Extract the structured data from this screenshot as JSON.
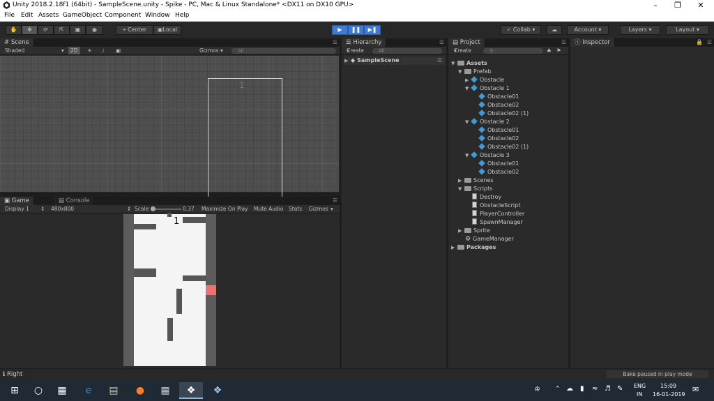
{
  "title_bar": {
    "title": "Unity 2018.2.18f1 (64bit) - SampleScene.unity - Spike - PC, Mac & Linux Standalone* <DX11 on DX10 GPU>"
  },
  "menu": [
    "File",
    "Edit",
    "Assets",
    "GameObject",
    "Component",
    "Window",
    "Help"
  ],
  "toolbar": {
    "pivot_center": "Center",
    "pivot_local": "Local",
    "collab": "Collab",
    "account": "Account",
    "layers": "Layers",
    "layout": "Layout"
  },
  "scene": {
    "tab": "Scene",
    "shading": "Shaded",
    "mode_2d": "2D",
    "gizmos": "Gizmos",
    "search": "All",
    "label": "1"
  },
  "game": {
    "tab_game": "Game",
    "tab_console": "Console",
    "display": "Display 1",
    "resolution": "480x800",
    "scale_label": "Scale",
    "scale_value": "0.37",
    "maximize": "Maximize On Play",
    "mute": "Mute Audio",
    "stats": "Stats",
    "gizmos": "Gizmos",
    "score": "1"
  },
  "hierarchy": {
    "tab": "Hierarchy",
    "create": "Create",
    "search": "All",
    "scene_name": "SampleScene"
  },
  "project": {
    "tab": "Project",
    "create": "Create",
    "tree": {
      "assets": "Assets",
      "prefab": "Prefab",
      "obstacle": "Obstacle",
      "obstacle1": "Obstacle 1",
      "o1a": "Obstacle01",
      "o1b": "Obstacle02",
      "o1c": "Obstacle02 (1)",
      "obstacle2": "Obstacle 2",
      "o2a": "Obstacle01",
      "o2b": "Obstacle02",
      "o2c": "Obstacle02 (1)",
      "obstacle3": "Obstacle 3",
      "o3a": "Obstacle01",
      "o3b": "Obstacle02",
      "scenes": "Scenes",
      "scripts": "Scripts",
      "destroy": "Destroy",
      "obstacle_script": "ObstacleScript",
      "player_controller": "PlayerController",
      "spawn_manager": "SpawnManager",
      "sprite": "Sprite",
      "game_manager": "GameManager",
      "packages": "Packages"
    }
  },
  "inspector": {
    "tab": "Inspector"
  },
  "status": {
    "left": "Right",
    "right": "Bake paused in play mode"
  },
  "taskbar": {
    "lang1": "ENG",
    "lang2": "IN",
    "time": "15:09",
    "date": "16-01-2019"
  },
  "colors": {
    "play_accent": "#3d7bd6",
    "player": "#ef7070",
    "obstacle": "#555555"
  }
}
